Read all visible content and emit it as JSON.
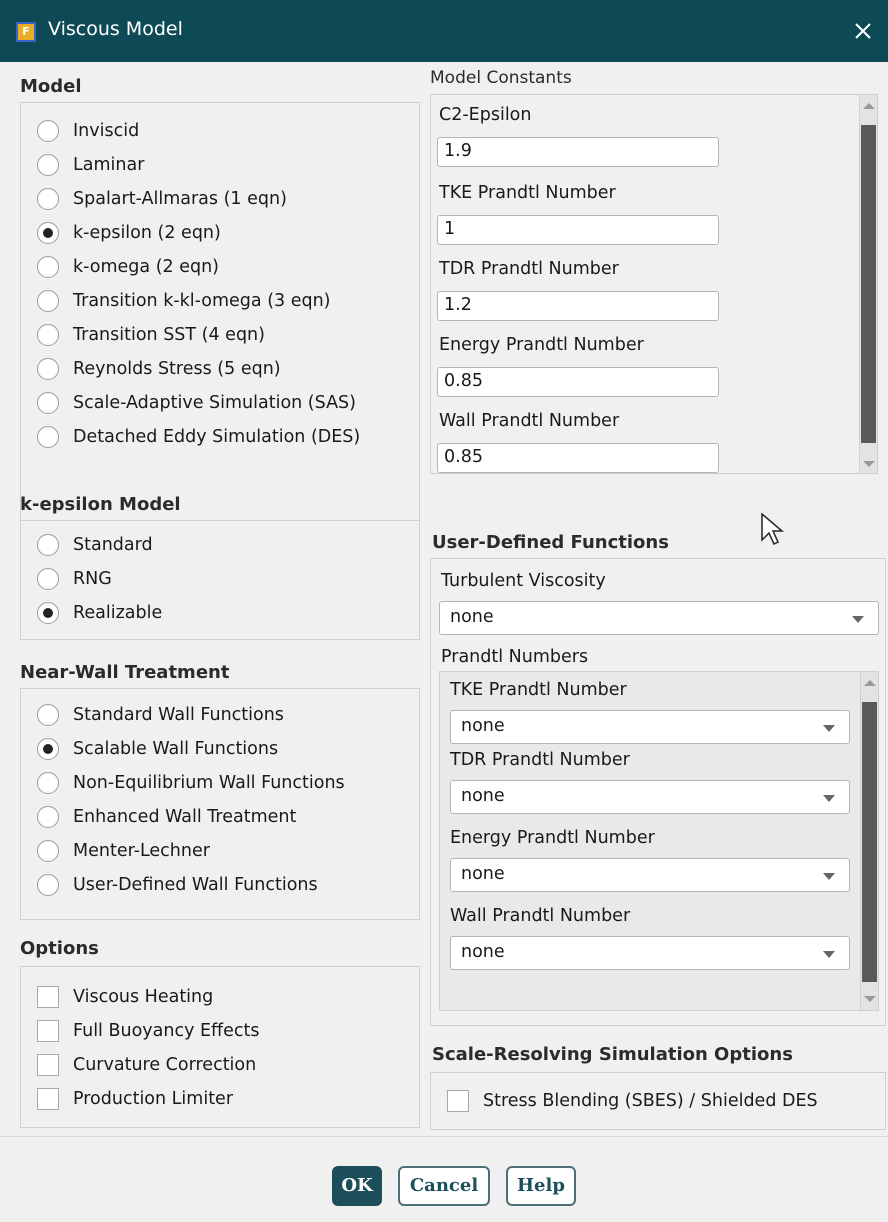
{
  "window": {
    "title": "Viscous Model",
    "app_icon_letter": "F"
  },
  "model": {
    "title": "Model",
    "options": [
      {
        "label": "Inviscid",
        "selected": false
      },
      {
        "label": "Laminar",
        "selected": false
      },
      {
        "label": "Spalart-Allmaras (1 eqn)",
        "selected": false
      },
      {
        "label": "k-epsilon (2 eqn)",
        "selected": true
      },
      {
        "label": "k-omega (2 eqn)",
        "selected": false
      },
      {
        "label": "Transition k-kl-omega (3 eqn)",
        "selected": false
      },
      {
        "label": "Transition SST (4 eqn)",
        "selected": false
      },
      {
        "label": "Reynolds Stress (5 eqn)",
        "selected": false
      },
      {
        "label": "Scale-Adaptive Simulation (SAS)",
        "selected": false
      },
      {
        "label": "Detached Eddy Simulation (DES)",
        "selected": false
      }
    ]
  },
  "k_epsilon_model": {
    "title": "k-epsilon Model",
    "options": [
      {
        "label": "Standard",
        "selected": false
      },
      {
        "label": "RNG",
        "selected": false
      },
      {
        "label": "Realizable",
        "selected": true
      }
    ]
  },
  "near_wall": {
    "title": "Near-Wall Treatment",
    "options": [
      {
        "label": "Standard Wall Functions",
        "selected": false
      },
      {
        "label": "Scalable Wall Functions",
        "selected": true
      },
      {
        "label": "Non-Equilibrium Wall Functions",
        "selected": false
      },
      {
        "label": "Enhanced Wall Treatment",
        "selected": false
      },
      {
        "label": "Menter-Lechner",
        "selected": false
      },
      {
        "label": "User-Defined Wall Functions",
        "selected": false
      }
    ]
  },
  "options": {
    "title": "Options",
    "items": [
      {
        "label": "Viscous Heating",
        "checked": false
      },
      {
        "label": "Full Buoyancy Effects",
        "checked": false
      },
      {
        "label": "Curvature Correction",
        "checked": false
      },
      {
        "label": "Production Limiter",
        "checked": false
      }
    ]
  },
  "model_constants": {
    "title": "Model Constants",
    "fields": [
      {
        "label": "C2-Epsilon",
        "value": "1.9"
      },
      {
        "label": "TKE Prandtl Number",
        "value": "1"
      },
      {
        "label": "TDR Prandtl Number",
        "value": "1.2"
      },
      {
        "label": "Energy Prandtl Number",
        "value": "0.85"
      },
      {
        "label": "Wall Prandtl Number",
        "value": "0.85"
      }
    ]
  },
  "udf": {
    "title": "User-Defined Functions",
    "turbulent_viscosity_label": "Turbulent Viscosity",
    "turbulent_viscosity_value": "none",
    "prandtl_numbers_title": "Prandtl Numbers",
    "prandtl": [
      {
        "label": "TKE Prandtl Number",
        "value": "none"
      },
      {
        "label": "TDR Prandtl Number",
        "value": "none"
      },
      {
        "label": "Energy Prandtl Number",
        "value": "none"
      },
      {
        "label": "Wall Prandtl Number",
        "value": "none"
      }
    ]
  },
  "srs": {
    "title": "Scale-Resolving Simulation Options",
    "stress_blending_label": "Stress Blending (SBES) / Shielded DES",
    "stress_blending_checked": false
  },
  "buttons": {
    "ok": "OK",
    "cancel": "Cancel",
    "help": "Help"
  },
  "colors": {
    "titlebar": "#0e4a56",
    "primary_button": "#1d4f5b"
  }
}
